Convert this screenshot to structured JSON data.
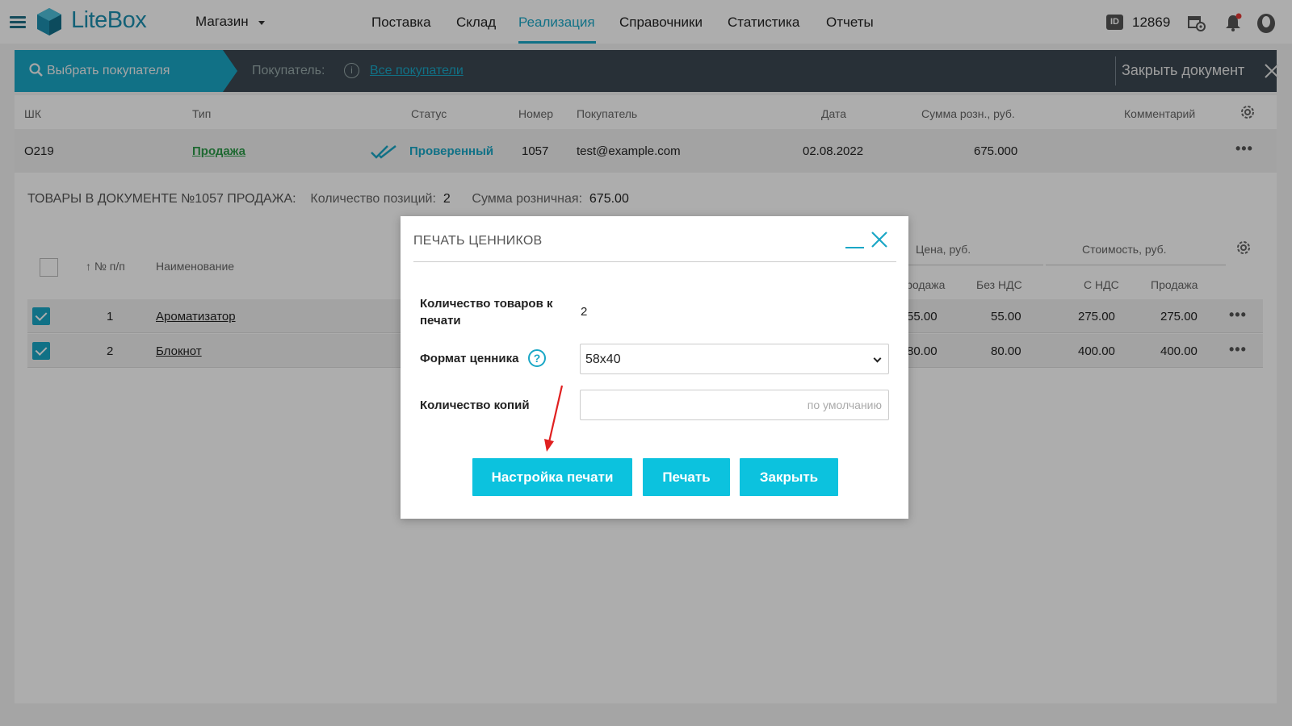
{
  "app": {
    "brand": "LiteBox",
    "store": "Магазин"
  },
  "nav": {
    "items": [
      {
        "label": "Поставка",
        "active": false
      },
      {
        "label": "Склад",
        "active": false
      },
      {
        "label": "Реализация",
        "active": true
      },
      {
        "label": "Справочники",
        "active": false
      },
      {
        "label": "Статистика",
        "active": false
      },
      {
        "label": "Отчеты",
        "active": false
      }
    ]
  },
  "account": {
    "id_label": "ID",
    "id": "12869"
  },
  "icons": {
    "menu": "hamburger-icon",
    "shop_settings": "store-settings-icon",
    "notifications": "bell-icon",
    "profile": "user-icon"
  },
  "docbar": {
    "search_label": "Выбрать покупателя",
    "buyer_label": "Покупатель:",
    "buyer_value": "Все покупатели",
    "close_label": "Закрыть документ"
  },
  "doc_table": {
    "headers": {
      "barcode": "ШК",
      "type": "Тип",
      "status": "Статус",
      "number": "Номер",
      "buyer": "Покупатель",
      "date": "Дата",
      "sum": "Сумма розн., руб.",
      "comment": "Комментарий"
    },
    "row": {
      "barcode": "O219",
      "type": "Продажа",
      "status": "Проверенный",
      "number": "1057",
      "buyer": "test@example.com",
      "date": "02.08.2022",
      "sum": "675.000",
      "comment": ""
    }
  },
  "goods": {
    "title": "ТОВАРЫ В ДОКУМЕНТЕ №1057 ПРОДАЖА:",
    "count_label": "Количество позиций:",
    "count": "2",
    "sum_label": "Сумма розничная:",
    "sum": "675.00",
    "headers": {
      "num": "№ п/п",
      "name": "Наименование",
      "price_group": "Цена, руб.",
      "cost_group": "Стоимость, руб.",
      "price_sale": "Продажа",
      "price_no_vat": "Без НДС",
      "cost_vat": "С НДС",
      "cost_sale": "Продажа"
    },
    "rows": [
      {
        "num": "1",
        "name": "Ароматизатор",
        "price_sale": "55.00",
        "price_no_vat": "55.00",
        "cost_vat": "275.00",
        "cost_sale": "275.00",
        "checked": true
      },
      {
        "num": "2",
        "name": "Блокнот",
        "price_sale": "80.00",
        "price_no_vat": "80.00",
        "cost_vat": "400.00",
        "cost_sale": "400.00",
        "checked": true
      }
    ]
  },
  "modal": {
    "title": "ПЕЧАТЬ ЦЕННИКОВ",
    "qty_label": "Количество товаров к печати",
    "qty_value": "2",
    "format_label": "Формат ценника",
    "format_value": "58x40",
    "copies_label": "Количество копий",
    "copies_placeholder": "по умолчанию",
    "btn_settings": "Настройка печати",
    "btn_print": "Печать",
    "btn_close": "Закрыть"
  },
  "colors": {
    "accent": "#1aa7c6",
    "button": "#0cc2de",
    "docbar": "#3b4752",
    "sale_green": "#2e9b4a",
    "annotation_arrow": "#e02020"
  }
}
